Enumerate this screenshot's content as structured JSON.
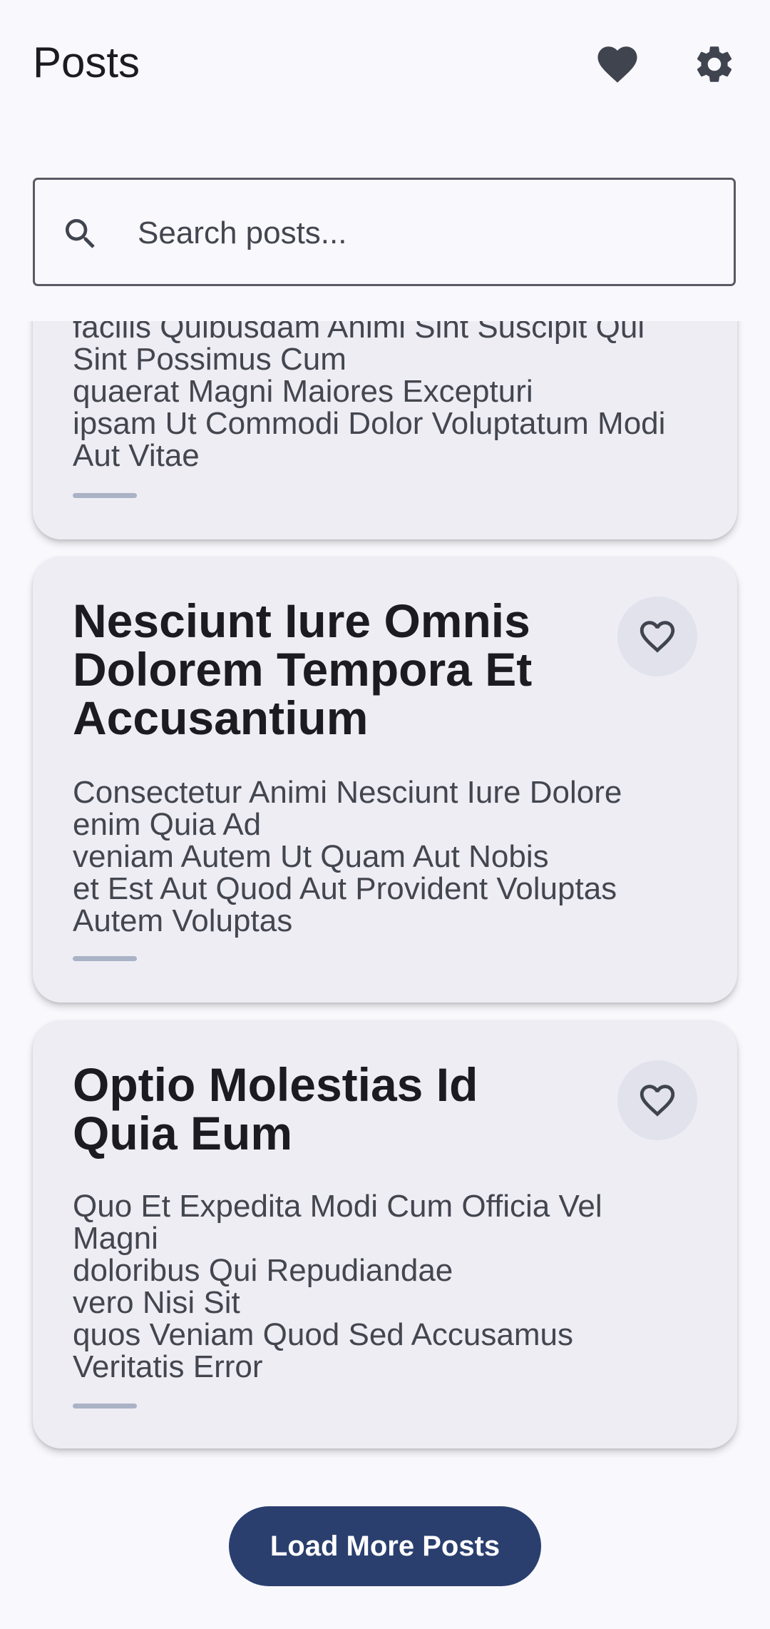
{
  "app": {
    "title": "Posts"
  },
  "header": {
    "favorites_icon": "heart-filled-icon",
    "settings_icon": "gear-icon"
  },
  "search": {
    "placeholder": "Search posts...",
    "value": ""
  },
  "posts": [
    {
      "title": "",
      "body": "facilis Quibusdam Animi Sint Suscipit Qui\nSint Possimus Cum\nquaerat Magni Maiores Excepturi\nipsam Ut Commodi Dolor Voluptatum Modi\nAut Vitae",
      "favorited": false
    },
    {
      "title": "Nesciunt Iure Omnis Dolorem Tempora Et Accusantium",
      "body": "Consectetur Animi Nesciunt Iure Dolore\nenim Quia Ad\nveniam Autem Ut Quam Aut Nobis\net Est Aut Quod Aut Provident Voluptas\nAutem Voluptas",
      "favorited": false
    },
    {
      "title": "Optio Molestias Id Quia Eum",
      "body": "Quo Et Expedita Modi Cum Officia Vel\nMagni\ndoloribus Qui Repudiandae\nvero Nisi Sit\nquos Veniam Quod Sed Accusamus\nVeritatis Error",
      "favorited": false
    }
  ],
  "load_more_label": "Load More Posts",
  "colors": {
    "background": "#f8f8fd",
    "card": "#eeedf4",
    "accent": "#2a3f6e",
    "divider": "#aab2c6",
    "icon": "#3f444f"
  }
}
